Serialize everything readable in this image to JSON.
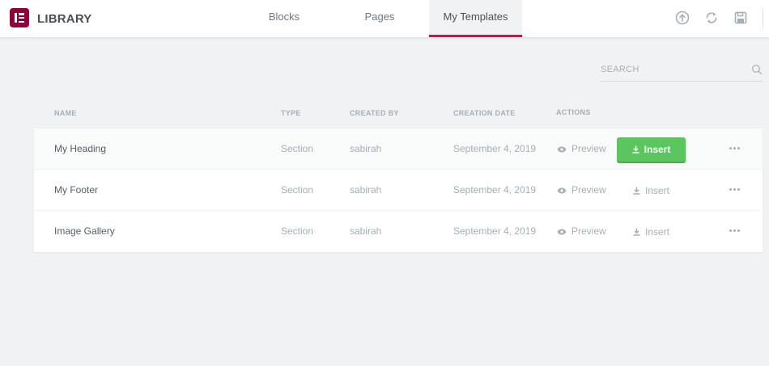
{
  "header": {
    "title": "LIBRARY",
    "logo_icon": "elementor-logo",
    "tabs": [
      {
        "label": "Blocks",
        "active": false
      },
      {
        "label": "Pages",
        "active": false
      },
      {
        "label": "My Templates",
        "active": true
      }
    ],
    "icons": [
      "upload-icon",
      "sync-icon",
      "save-icon"
    ]
  },
  "search": {
    "placeholder": "SEARCH",
    "value": ""
  },
  "columns": {
    "name": "NAME",
    "type": "TYPE",
    "created_by": "CREATED BY",
    "creation_date": "CREATION DATE",
    "actions": "ACTIONS"
  },
  "rows": [
    {
      "name": "My Heading",
      "type": "Section",
      "created_by": "sabirah",
      "date": "September 4, 2019",
      "preview": "Preview",
      "insert": "Insert"
    },
    {
      "name": "My Footer",
      "type": "Section",
      "created_by": "sabirah",
      "date": "September 4, 2019",
      "preview": "Preview",
      "insert": "Insert"
    },
    {
      "name": "Image Gallery",
      "type": "Section",
      "created_by": "sabirah",
      "date": "September 4, 2019",
      "preview": "Preview",
      "insert": "Insert"
    }
  ],
  "colors": {
    "accent": "#d30c5c",
    "logo": "#92003b",
    "insert_green": "#5bc65f",
    "background": "#f1f2f3"
  }
}
